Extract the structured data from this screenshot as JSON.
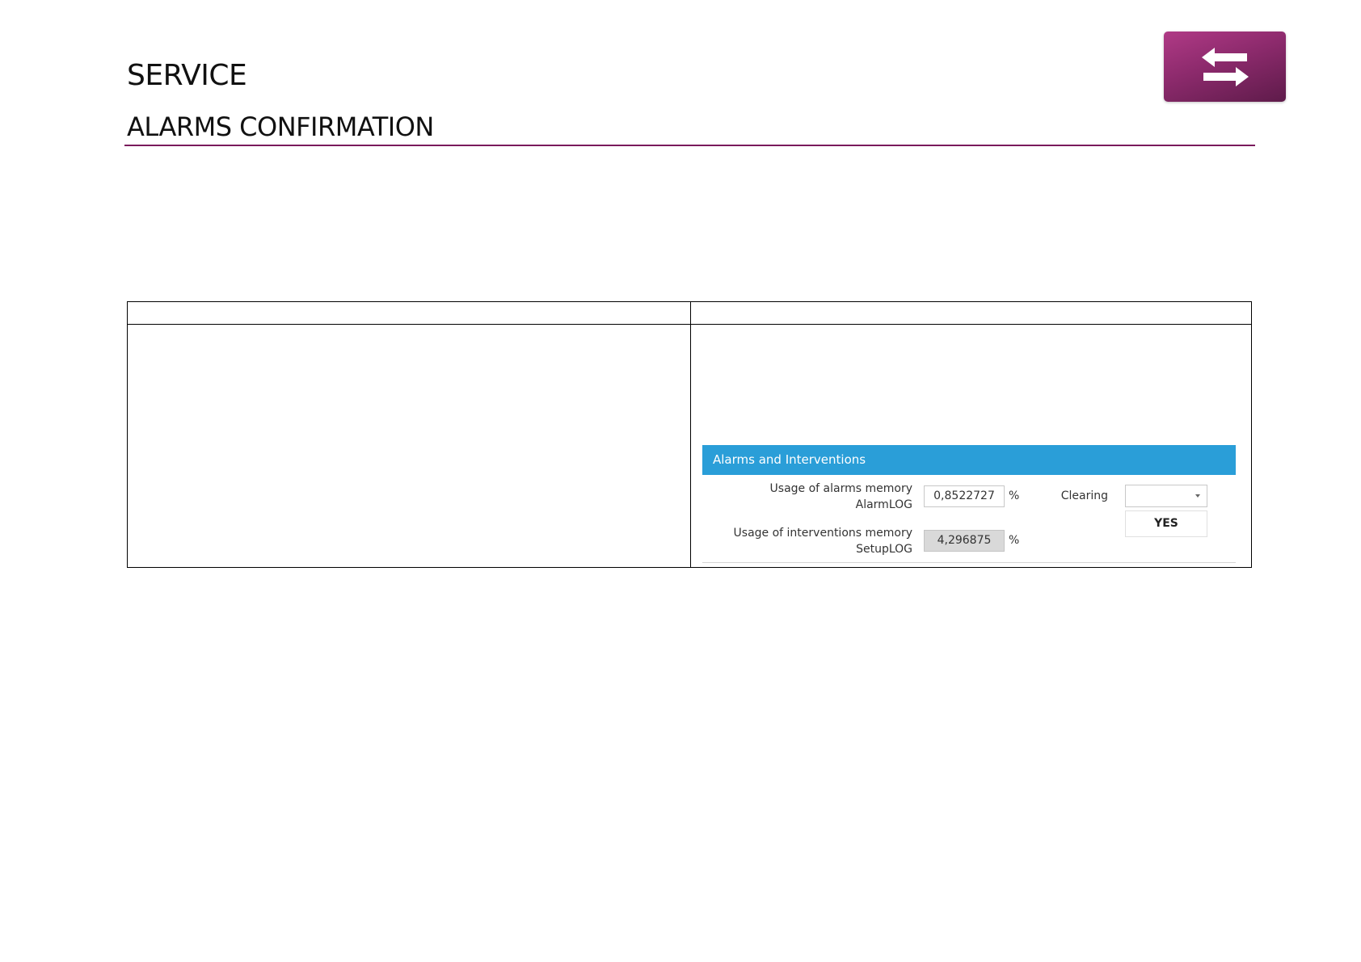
{
  "header": {
    "section": "SERVICE",
    "title": "ALARMS CONFIRMATION",
    "nav_icon": "swap-arrows-icon",
    "rule_color": "#7a1a5c",
    "button_color": "#8c2a6c"
  },
  "table": {
    "header_left": "",
    "header_right": "",
    "body_left": ""
  },
  "panel": {
    "title": "Alarms and Interventions",
    "accent": "#2a9ed8",
    "alarms": {
      "label": "Usage of alarms memory",
      "sublabel": "AlarmLOG",
      "value": "0,8522727",
      "unit": "%"
    },
    "interventions": {
      "label": "Usage of interventions memory",
      "sublabel": "SetupLOG",
      "value": "4,296875",
      "unit": "%"
    },
    "clearing": {
      "label": "Clearing",
      "selected": "",
      "option_yes": "YES"
    }
  }
}
